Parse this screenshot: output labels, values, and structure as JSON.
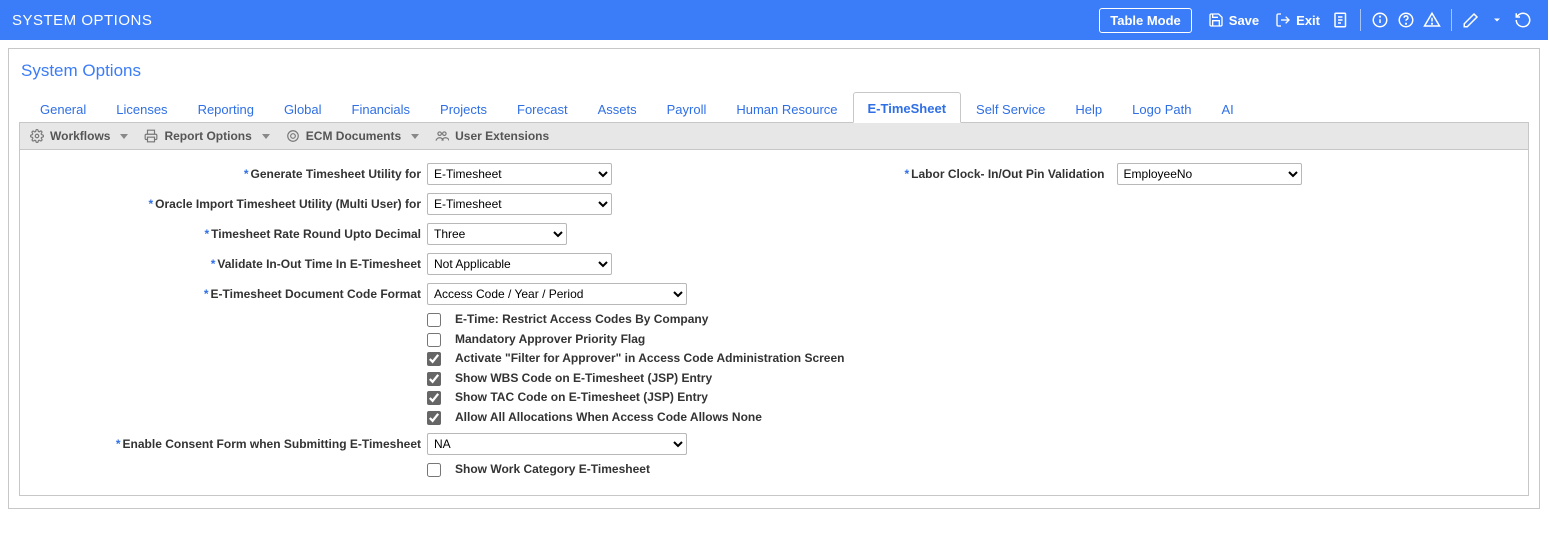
{
  "topbar": {
    "title": "SYSTEM OPTIONS",
    "table_mode": "Table Mode",
    "save": "Save",
    "exit": "Exit"
  },
  "panel": {
    "title": "System Options"
  },
  "tabs": [
    {
      "label": "General"
    },
    {
      "label": "Licenses"
    },
    {
      "label": "Reporting"
    },
    {
      "label": "Global"
    },
    {
      "label": "Financials"
    },
    {
      "label": "Projects"
    },
    {
      "label": "Forecast"
    },
    {
      "label": "Assets"
    },
    {
      "label": "Payroll"
    },
    {
      "label": "Human Resource"
    },
    {
      "label": "E-TimeSheet"
    },
    {
      "label": "Self Service"
    },
    {
      "label": "Help"
    },
    {
      "label": "Logo Path"
    },
    {
      "label": "AI"
    }
  ],
  "tabs_active_index": 10,
  "toolbar": {
    "workflows": "Workflows",
    "report_options": "Report Options",
    "ecm_documents": "ECM Documents",
    "user_extensions": "User Extensions"
  },
  "form": {
    "generate_ts_util_label": "Generate Timesheet Utility for",
    "generate_ts_util_value": "E-Timesheet",
    "oracle_import_label": "Oracle Import Timesheet Utility (Multi User) for",
    "oracle_import_value": "E-Timesheet",
    "rate_round_label": "Timesheet Rate Round Upto Decimal",
    "rate_round_value": "Three",
    "validate_inout_label": "Validate In-Out Time In E-Timesheet",
    "validate_inout_value": "Not Applicable",
    "doc_code_format_label": "E-Timesheet Document Code Format",
    "doc_code_format_value": "Access Code / Year / Period",
    "chk_restrict_access": "E-Time: Restrict Access Codes By Company",
    "chk_restrict_access_checked": false,
    "chk_mandatory_approver": "Mandatory Approver Priority Flag",
    "chk_mandatory_approver_checked": false,
    "chk_filter_for_approver": "Activate \"Filter for Approver\" in Access Code Administration Screen",
    "chk_filter_for_approver_checked": true,
    "chk_show_wbs": "Show WBS Code on E-Timesheet (JSP) Entry",
    "chk_show_wbs_checked": true,
    "chk_show_tac": "Show TAC Code on E-Timesheet (JSP) Entry",
    "chk_show_tac_checked": true,
    "chk_allow_all_alloc": "Allow All Allocations When Access Code Allows None",
    "chk_allow_all_alloc_checked": true,
    "consent_label": "Enable Consent Form when Submitting E-Timesheet",
    "consent_value": "NA",
    "chk_show_work_cat": "Show Work Category E-Timesheet",
    "chk_show_work_cat_checked": false,
    "labor_clock_label": "Labor Clock- In/Out Pin Validation",
    "labor_clock_value": "EmployeeNo"
  }
}
